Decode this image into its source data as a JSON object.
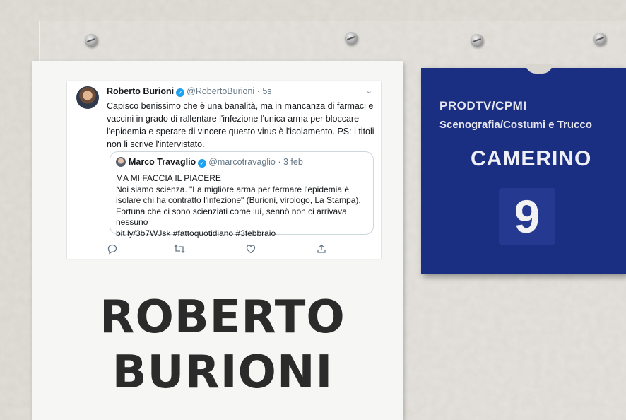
{
  "tweet": {
    "author_name": "Roberto Burioni",
    "handle": "@RobertoBurioni",
    "time": "· 5s",
    "text": "Capisco benissimo che è una banalità, ma in mancanza di farmaci e vaccini in grado di rallentare l'infezione l'unica arma per bloccare l'epidemia e sperare di vincere questo virus è l'isolamento. PS: i titoli non li scrive l'intervistato.",
    "quoted": {
      "author_name": "Marco Travaglio",
      "handle": "@marcotravaglio",
      "time": "· 3 feb",
      "line1": "MA MI FACCIA IL PIACERE",
      "line2": "Noi siamo scienza. \"La migliore arma per fermare l'epidemia è isolare chi ha contratto l'infezione\" (Burioni, virologo, La Stampa). Fortuna che ci sono scienziati come lui, sennò non ci arrivava nessuno",
      "line3": "bit.ly/3b7WJsk #fattoquotidiano #3febbraio"
    },
    "icons": [
      "reply-icon",
      "retweet-icon",
      "like-icon",
      "share-icon"
    ]
  },
  "paper_sign": {
    "line1": "ROBERTO",
    "line2": "BURIONI"
  },
  "door_sign": {
    "line1": "PRODTV/CPMI",
    "line2": "Scenografia/Costumi e Trucco",
    "line3": "CAMERINO",
    "number": "9"
  },
  "colors": {
    "sign_blue": "#1b2f82",
    "twitter_blue": "#1da1f2",
    "wall": "#d9d6cf"
  }
}
